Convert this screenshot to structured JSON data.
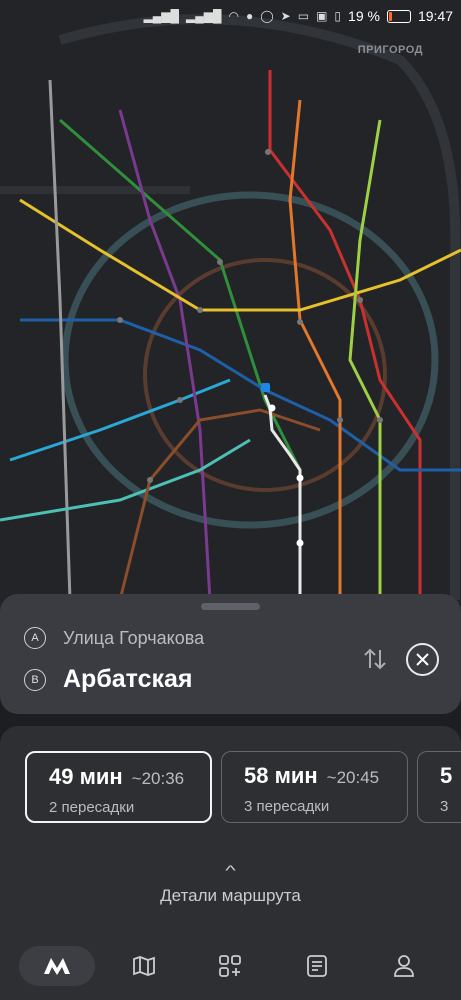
{
  "status_bar": {
    "battery_percent": "19 %",
    "time": "19:47",
    "icons": [
      "signal-icon",
      "signal-icon",
      "wifi-icon",
      "viber-icon",
      "whatsapp-icon",
      "telegram-icon",
      "messenger-icon",
      "app-icon",
      "vibrate-icon",
      "battery-icon"
    ]
  },
  "map": {
    "suburb_label": "ПРИГОРОД",
    "line_colors": [
      "#c9312f",
      "#2f8f3a",
      "#1f5fa8",
      "#2aa7d6",
      "#8b4d2a",
      "#e2762b",
      "#7a3a8f",
      "#e6c12c",
      "#9a9a9a",
      "#9ed046",
      "#4ebfb4",
      "#d2d2d2"
    ]
  },
  "route": {
    "from_letter": "A",
    "from_name": "Улица Горчакова",
    "to_letter": "B",
    "to_name": "Арбатская"
  },
  "options": [
    {
      "duration": "49 мин",
      "arrival": "~20:36",
      "transfers": "2 пересадки"
    },
    {
      "duration": "58 мин",
      "arrival": "~20:45",
      "transfers": "3 пересадки"
    },
    {
      "duration": "5",
      "arrival": "",
      "transfers": "3"
    }
  ],
  "details_label": "Детали маршрута",
  "nav": {
    "items": [
      "metro-logo-icon",
      "map-icon",
      "services-icon",
      "tickets-icon",
      "profile-icon"
    ]
  }
}
